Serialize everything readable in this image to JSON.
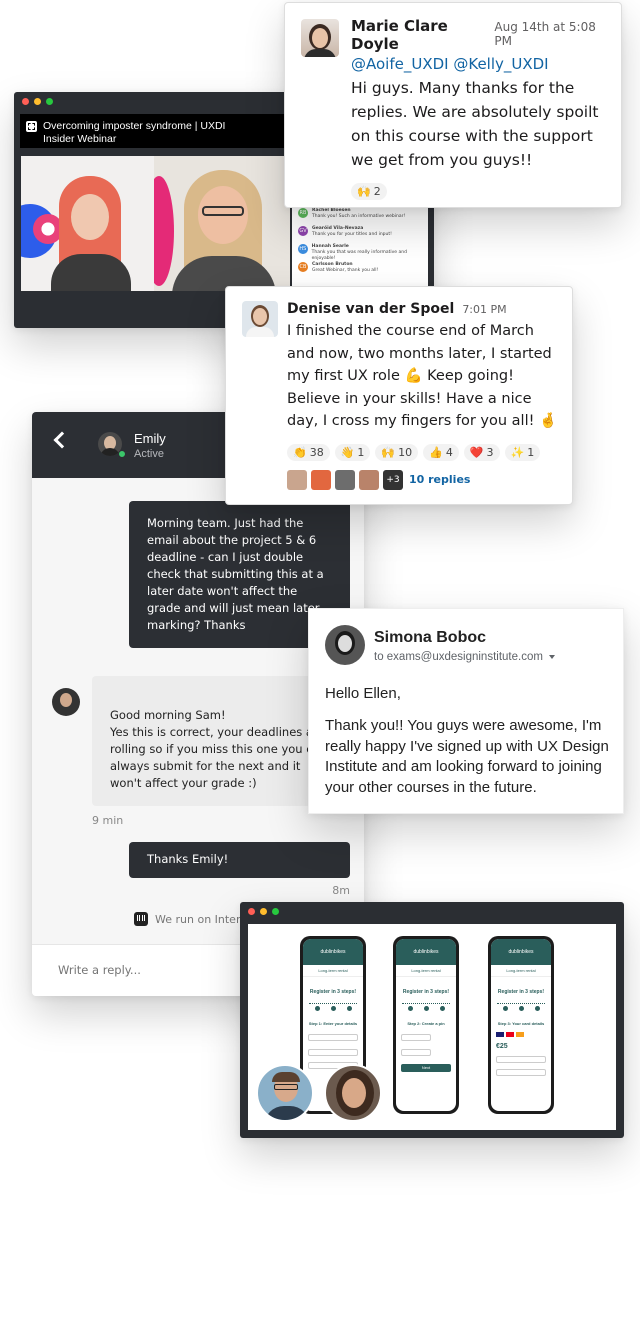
{
  "webinar": {
    "title_line1": "Overcoming imposter syndrome | UXDI",
    "title_line2": "Insider Webinar",
    "chat": [
      {
        "initials": "RB",
        "name": "Rachel Bloesen",
        "text": "Thank you! Such an informative webinar!",
        "color": "#5cb85c"
      },
      {
        "initials": "GV",
        "name": "Gearóid Vila-Nevaza",
        "text": "Thank you for your titles and input!",
        "color": "#8e44ad"
      },
      {
        "initials": "HS",
        "name": "Hannah Searle",
        "text": "Thank you that was really informative and enjoyable!",
        "color": "#3b8de0"
      },
      {
        "initials": "CB",
        "name": "Carlsson Bruton",
        "text": "Great Webinar, thank you all!",
        "color": "#e67e22"
      }
    ]
  },
  "slack1": {
    "name": "Marie Clare Doyle",
    "time": "Aug 14th at 5:08 PM",
    "mentions": "@Aoife_UXDI @Kelly_UXDI",
    "body": "Hi guys. Many thanks for the replies. We are absolutely spoilt on this course with the support we get from you guys!!",
    "reaction_emoji": "🙌",
    "reaction_count": "2"
  },
  "slack2": {
    "name": "Denise van der Spoel",
    "time": "7:01 PM",
    "body": "I finished the course end of March and now, two months later, I started my first UX role 💪 Keep going! Believe in your skills! Have a nice day, I cross my fingers for you all! 🤞",
    "reactions": [
      {
        "emoji": "👏",
        "count": "38"
      },
      {
        "emoji": "👋",
        "count": "1"
      },
      {
        "emoji": "🙌",
        "count": "10"
      },
      {
        "emoji": "👍",
        "count": "4"
      },
      {
        "emoji": "❤️",
        "count": "3"
      },
      {
        "emoji": "✨",
        "count": "1"
      }
    ],
    "more_avatars": "+3",
    "replies": "10 replies"
  },
  "intercom": {
    "contact_name": "Emily",
    "contact_status": "Active",
    "messages": [
      {
        "text": "Morning team. Just had the email about the project 5 & 6 deadline - can I just double check that submitting this at a later date won't affect the grade and will just mean later marking? Thanks"
      },
      {
        "text": "Good morning Sam!\nYes this is correct, your deadlines are rolling so if you miss this one you can always submit for the next and it won't affect your grade :)",
        "time": "9 min"
      },
      {
        "text": "Thanks Emily!",
        "time": "8m"
      }
    ],
    "footer": "We run on Inter",
    "reply_placeholder": "Write a reply..."
  },
  "email": {
    "sender": "Simona Boboc",
    "to": "to exams@uxdesigninstitute.com",
    "greeting": "Hello Ellen,",
    "body": "Thank you!! You guys were awesome, I'm really happy I've signed up with UX Design Institute and am looking forward to joining your other courses in the future."
  },
  "phones": [
    {
      "brand": "dublinbikes",
      "header": "Long-term rental",
      "title": "Register in 3 steps!",
      "step": "Step 1: Enter your details"
    },
    {
      "brand": "dublinbikes",
      "header": "Long-term rental",
      "title": "Register in 3 steps!",
      "step": "Step 2: Create a pin",
      "button": "Next"
    },
    {
      "brand": "dublinbikes",
      "header": "Long-term rental",
      "title": "Register in 3 steps!",
      "step": "Step 3: Your card details",
      "amount": "€25"
    }
  ]
}
